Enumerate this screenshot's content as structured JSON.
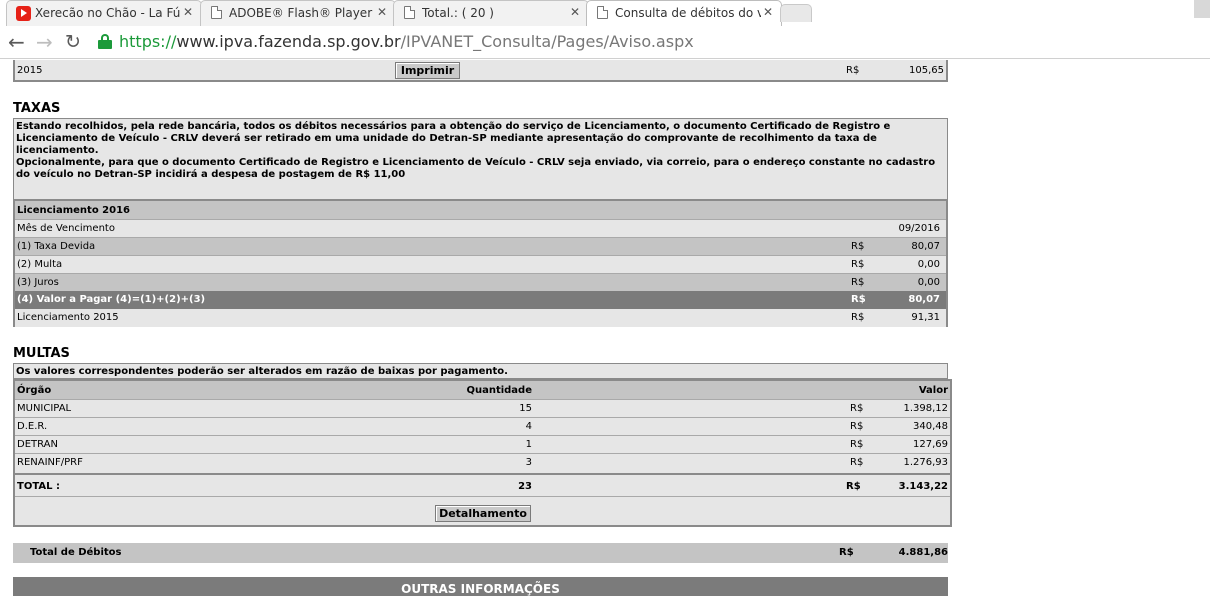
{
  "browser": {
    "tabs": [
      {
        "label": "Xerecão no Chão - La Fúria",
        "icon": "youtube-icon"
      },
      {
        "label": "ADOBE® Flash® Player",
        "icon": "document-icon"
      },
      {
        "label": "Total.: ( 20 )",
        "icon": "document-icon"
      },
      {
        "label": "Consulta de débitos do veículo",
        "icon": "document-icon"
      }
    ],
    "url": {
      "scheme": "https://",
      "host": "www.ipva.fazenda.sp.gov.br",
      "path": "/IPVANET_Consulta/Pages/Aviso.aspx"
    }
  },
  "top_row": {
    "year": "2015",
    "print_label": "Imprimir",
    "currency": "R$",
    "value": "105,65"
  },
  "taxas": {
    "title": "TAXAS",
    "notice_1": "Estando recolhidos, pela rede bancária, todos os débitos necessários para a obtenção do serviço de Licenciamento, o documento Certificado de Registro e Licenciamento de Veículo - CRLV deverá ser retirado em uma unidade do Detran-SP mediante apresentação do comprovante de recolhimento da taxa de licenciamento.",
    "notice_2": "Opcionalmente, para que o documento Certificado de Registro e Licenciamento de Veículo - CRLV seja enviado, via correio, para o endereço constante no cadastro do veículo no Detran-SP incidirá a despesa de postagem de R$ 11,00",
    "header": "Licenciamento 2016",
    "due_label": "Mês de Vencimento",
    "due_value": "09/2016",
    "rows": [
      {
        "label": "(1) Taxa Devida",
        "currency": "R$",
        "value": "80,07"
      },
      {
        "label": "(2) Multa",
        "currency": "R$",
        "value": "0,00"
      },
      {
        "label": "(3) Juros",
        "currency": "R$",
        "value": "0,00"
      },
      {
        "label": "(4) Valor a Pagar (4)=(1)+(2)+(3)",
        "currency": "R$",
        "value": "80,07"
      },
      {
        "label": "Licenciamento 2015",
        "currency": "R$",
        "value": "91,31"
      }
    ]
  },
  "multas": {
    "title": "MULTAS",
    "notice": "Os valores correspondentes poderão ser alterados em razão de baixas por pagamento.",
    "headers": {
      "orgao": "Órgão",
      "quantidade": "Quantidade",
      "valor": "Valor"
    },
    "rows": [
      {
        "orgao": "MUNICIPAL",
        "quantidade": "15",
        "currency": "R$",
        "valor": "1.398,12"
      },
      {
        "orgao": "D.E.R.",
        "quantidade": "4",
        "currency": "R$",
        "valor": "340,48"
      },
      {
        "orgao": "DETRAN",
        "quantidade": "1",
        "currency": "R$",
        "valor": "127,69"
      },
      {
        "orgao": "RENAINF/PRF",
        "quantidade": "3",
        "currency": "R$",
        "valor": "1.276,93"
      }
    ],
    "total": {
      "label": "TOTAL :",
      "quantidade": "23",
      "currency": "R$",
      "valor": "3.143,22"
    },
    "detail_button": "Detalhamento"
  },
  "total_debitos": {
    "label": "Total de Débitos",
    "currency": "R$",
    "value": "4.881,86"
  },
  "outras": {
    "title": "OUTRAS INFORMAÇÕES"
  }
}
